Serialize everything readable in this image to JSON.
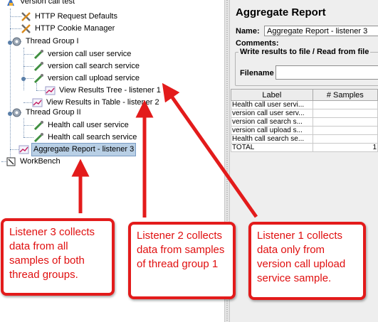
{
  "tree": {
    "root": "Version call test",
    "http_defaults": "HTTP Request Defaults",
    "cookie_manager": "HTTP Cookie Manager",
    "thread_group_1": "Thread Group I",
    "tg1_samplers": [
      "version call user service",
      "version call search service",
      "version call upload service"
    ],
    "listener_1": "View Results Tree - listener 1",
    "listener_2": "View Results in Table - listener 2",
    "thread_group_2": "Thread Group II",
    "tg2_samplers": [
      "Health call user service",
      "Health call search service"
    ],
    "listener_3": "Aggregate Report - listener 3",
    "workbench": "WorkBench"
  },
  "panel": {
    "title": "Aggregate Report",
    "name_label": "Name:",
    "name_value": "Aggregate Report - listener 3",
    "comments_label": "Comments:",
    "write_results_title": "Write results to file / Read from file",
    "filename_label": "Filename",
    "table": {
      "headers": [
        "Label",
        "# Samples"
      ],
      "rows": [
        [
          "Health call user servi...",
          ""
        ],
        [
          "version call user serv...",
          ""
        ],
        [
          "version call search s...",
          ""
        ],
        [
          "version call upload s...",
          ""
        ],
        [
          "Health call search se...",
          ""
        ],
        [
          "TOTAL",
          "1"
        ]
      ]
    }
  },
  "callouts": {
    "listener3": "Listener 3 collects data from all samples of both thread groups.",
    "listener2": "Listener 2 collects data from samples of thread group 1",
    "listener1": "Listener 1 collects data only from version call upload service sample."
  },
  "colors": {
    "callout_red": "#e31b1b",
    "selection_bg": "#b8cfe5"
  }
}
